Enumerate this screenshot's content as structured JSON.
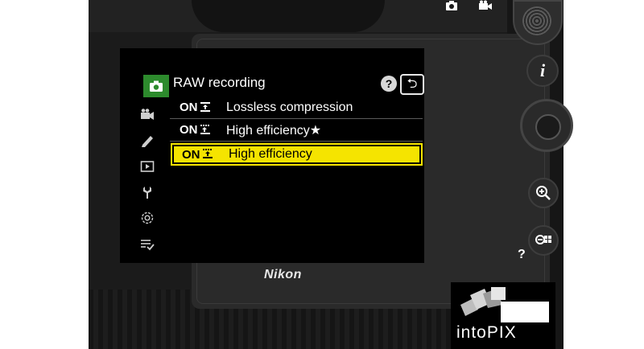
{
  "screen": {
    "title": "RAW recording",
    "help_label": "?",
    "back_label": "⮌",
    "menu_items": [
      {
        "tag": "ON",
        "label": "Lossless compression",
        "selected": false
      },
      {
        "tag": "ON",
        "label": "High efficiency★",
        "selected": false
      },
      {
        "tag": "ON",
        "label": "High efficiency",
        "selected": true
      }
    ],
    "sidebar": [
      {
        "icon": "photo-shooting-menu-icon"
      },
      {
        "icon": "video-recording-menu-icon"
      },
      {
        "icon": "custom-settings-pencil-icon"
      },
      {
        "icon": "playback-menu-icon"
      },
      {
        "icon": "setup-wrench-icon"
      },
      {
        "icon": "network-menu-icon"
      },
      {
        "icon": "my-menu-icon"
      }
    ],
    "colors": {
      "accent_selected": "#f5e400",
      "active_tab": "#2d8b2d"
    }
  },
  "camera": {
    "brand": "Nikon",
    "side_buttons": [
      "i",
      "zoom-in",
      "zoom-out"
    ],
    "help_mark": "?"
  },
  "watermark": {
    "text": "intoPIX"
  }
}
